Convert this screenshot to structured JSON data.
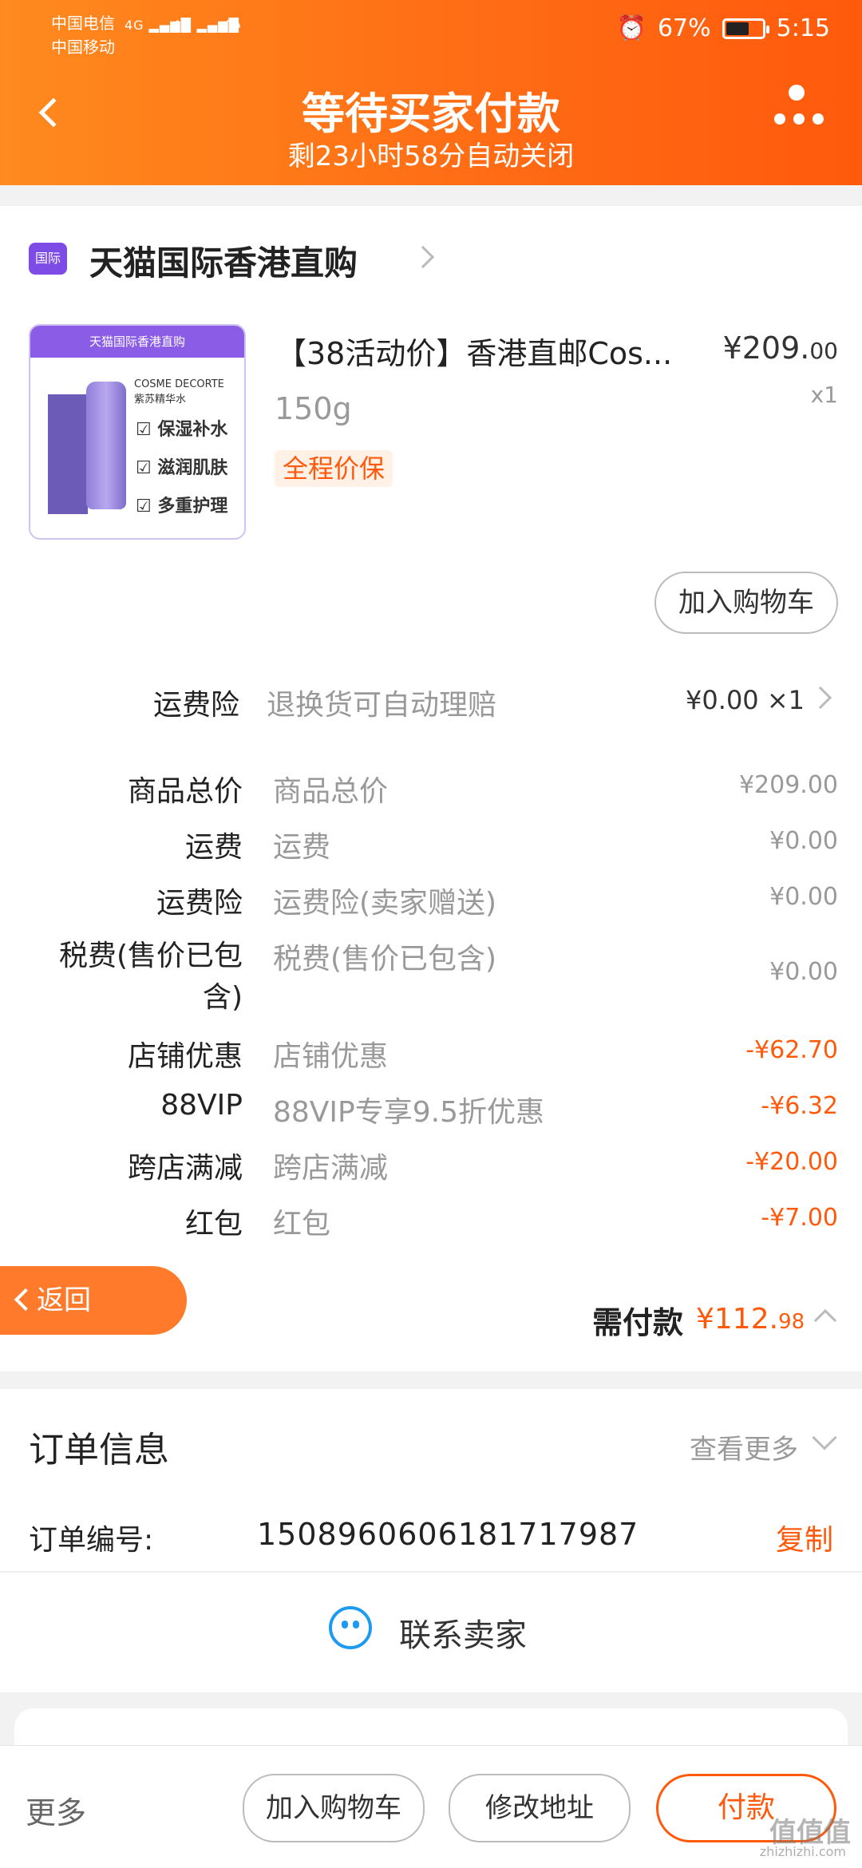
{
  "status_bar": {
    "carrier1": "中国电信",
    "carrier2": "中国移动",
    "signal1": "4G",
    "signal2": "4G",
    "battery_percent": "67%",
    "time": "5:15"
  },
  "header": {
    "title": "等待买家付款",
    "subtitle": "剩23小时58分自动关闭"
  },
  "store": {
    "badge": "国际",
    "name": "天猫国际香港直购"
  },
  "product": {
    "image": {
      "band_text": "天猫国际香港直购",
      "brand": "COSME DECORTE",
      "sub": "紫苏精华水",
      "features": [
        "保湿补水",
        "滋润肌肤",
        "多重护理"
      ]
    },
    "title": "【38活动价】香港直邮Cos...",
    "price_main": "¥209.",
    "price_decimal": "00",
    "quantity": "x1",
    "spec": "150g",
    "tag": "全程价保",
    "add_cart_label": "加入购物车"
  },
  "shipping_insurance": {
    "label": "运费险",
    "desc": "退换货可自动理赔",
    "value": "¥0.00 ×1"
  },
  "price_rows": [
    {
      "label": "商品总价",
      "desc": "商品总价",
      "value": "¥209.00",
      "negative": false
    },
    {
      "label": "运费",
      "desc": "运费",
      "value": "¥0.00",
      "negative": false
    },
    {
      "label": "运费险",
      "desc": "运费险(卖家赠送)",
      "value": "¥0.00",
      "negative": false
    },
    {
      "label": "税费(售价已包含)",
      "desc": "税费(售价已包含)",
      "value": "¥0.00",
      "negative": false
    },
    {
      "label": "店铺优惠",
      "desc": "店铺优惠",
      "value": "-¥62.70",
      "negative": true
    },
    {
      "label": "88VIP",
      "desc": "88VIP专享9.5折优惠",
      "value": "-¥6.32",
      "negative": true
    },
    {
      "label": "跨店满减",
      "desc": "跨店满减",
      "value": "-¥20.00",
      "negative": true
    },
    {
      "label": "红包",
      "desc": "红包",
      "value": "-¥7.00",
      "negative": true
    }
  ],
  "back_label": "返回",
  "total": {
    "label": "需付款",
    "value_main": "¥112.",
    "value_decimal": "98"
  },
  "order_info": {
    "title": "订单信息",
    "more": "查看更多",
    "number_label": "订单编号:",
    "number": "1508960606181717987",
    "copy": "复制"
  },
  "contact_seller": "联系卖家",
  "bottom_bar": {
    "more": "更多",
    "add_cart": "加入购物车",
    "modify_address": "修改地址",
    "pay": "付款"
  },
  "watermark": {
    "text": "值值值",
    "url": "zhizhizhi.com"
  },
  "colors": {
    "header_orange": "#ff6a14",
    "accent": "#ff5a0c",
    "contact_blue": "#1e9bf0"
  }
}
